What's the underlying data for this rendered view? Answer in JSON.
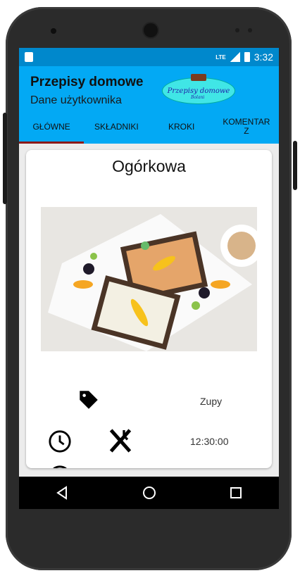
{
  "status_bar": {
    "network": "LTE",
    "time": "3:32"
  },
  "app_bar": {
    "title": "Przepisy domowe",
    "subtitle": "Dane użytkownika",
    "logo_text": "Przepisy domowe",
    "logo_subtext": "Bolani"
  },
  "tabs": [
    {
      "label": "GŁÓWNE",
      "active": true
    },
    {
      "label": "SKŁADNIKI",
      "active": false
    },
    {
      "label": "KROKI",
      "active": false
    },
    {
      "label": "KOMENTAR\nZ",
      "active": false
    }
  ],
  "recipe": {
    "name": "Ogórkowa",
    "category": "Zupy",
    "time": "12:30:00"
  },
  "icons": {
    "category": "tag-icon",
    "time": "clock-icon",
    "cutlery": "cutlery-icon"
  },
  "colors": {
    "status_bar": "#0088cc",
    "app_bar": "#03a9f4",
    "tab_indicator": "#8b1a1a",
    "logo": "#40e6e6"
  }
}
